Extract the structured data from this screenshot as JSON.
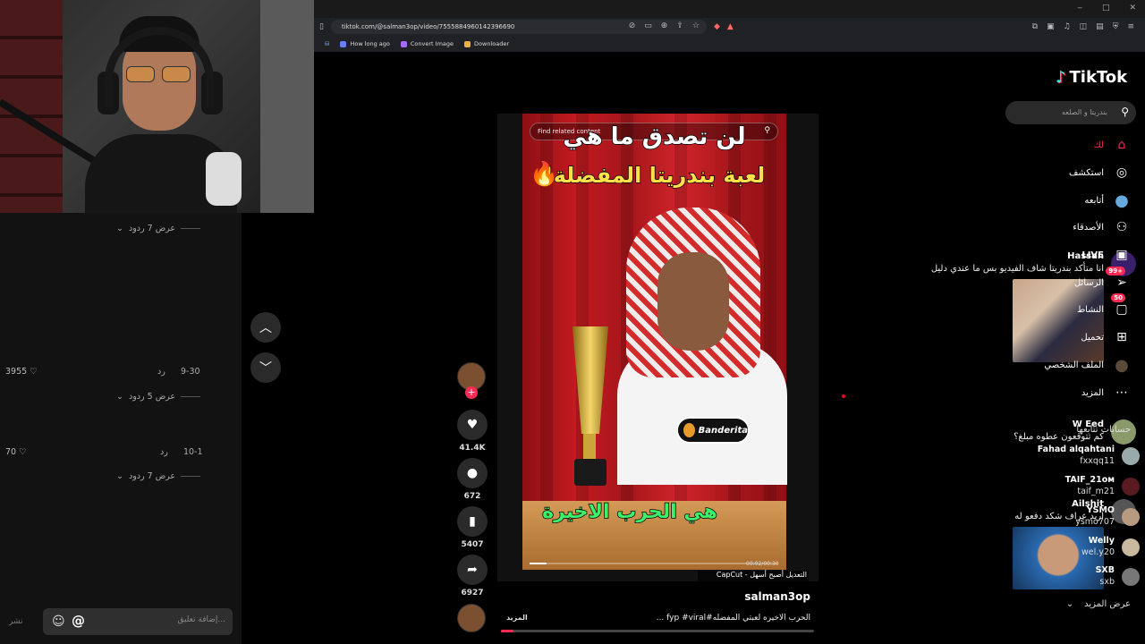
{
  "browser": {
    "url": "tiktok.com/@salman3op/video/7555884960142396690",
    "bookmarks": [
      "How long ago",
      "Convert Image",
      "Downloader"
    ],
    "window_controls": [
      "‒",
      "□",
      "✕"
    ]
  },
  "comments_panel": {
    "reply_toggles": [
      "عرض 7 ردود",
      "عرض 5 ردود",
      "عرض 7 ردود"
    ],
    "comments": [
      {
        "user": "Hassan",
        "text": "انا متأكد بندريتا شاف الفيديو بس ما عندي دليل",
        "date": "9-30",
        "reply": "رد",
        "likes": "3955",
        "avatar_color": "#3a1f6a"
      },
      {
        "user": "W Eed",
        "text": "كم تتوقعون عطوه مبلغ؟",
        "date": "10-1",
        "reply": "رد",
        "likes": "70",
        "avatar_color": "#8a9a6a"
      },
      {
        "user": "Ailshit",
        "text": "اريد عراف شكد دفعو له",
        "date": "",
        "reply": "",
        "likes": "",
        "avatar_color": "#555"
      }
    ],
    "input_placeholder": "إضافة تعليق...",
    "post_label": "نشر"
  },
  "video": {
    "search_placeholder": "Find related content",
    "headline_line1": "لن تصدق ما هي",
    "headline_line2": "لعبة بندريتا المفضلة!",
    "bottom_caption": "هي الحرب الاخيرة",
    "sticker_label": "Banderita",
    "time": "00:02/00:30",
    "progress": 0.07,
    "capcut_label": "التعديل أصبح أسهل - CapCut",
    "author": "salman3op",
    "description": "الحرب الاخيره لعبتي المفضله#fyp #viral ...",
    "more_label": "المزيد"
  },
  "actions": {
    "likes": "41.4K",
    "comments": "672",
    "saves": "5407",
    "shares": "6927"
  },
  "sidebar": {
    "logo": "TikTok",
    "search_placeholder": "بندريتا و الصلعه",
    "menu": [
      {
        "label": "لك",
        "icon": "home-icon",
        "glyph": "⌂",
        "badge": ""
      },
      {
        "label": "استكشف",
        "icon": "compass-icon",
        "glyph": "◎",
        "badge": ""
      },
      {
        "label": "أتابعه",
        "icon": "following-avatar-icon",
        "glyph": "●",
        "badge": ""
      },
      {
        "label": "الأصدقاء",
        "icon": "friends-icon",
        "glyph": "⚇",
        "badge": ""
      },
      {
        "label": "LIVE",
        "icon": "live-icon",
        "glyph": "▣",
        "badge": ""
      },
      {
        "label": "الرسائل",
        "icon": "messages-icon",
        "glyph": "➢",
        "badge": "99+"
      },
      {
        "label": "النشاط",
        "icon": "activity-icon",
        "glyph": "▢",
        "badge": "50"
      },
      {
        "label": "تحميل",
        "icon": "upload-icon",
        "glyph": "⊞",
        "badge": ""
      },
      {
        "label": "الملف الشخصي",
        "icon": "profile-avatar-icon",
        "glyph": "●",
        "badge": ""
      },
      {
        "label": "المزيد",
        "icon": "more-icon",
        "glyph": "⋯",
        "badge": ""
      }
    ],
    "following_title": "حسابات تتابعها",
    "following": [
      {
        "name": "Fahad alqahtani",
        "handle": "fxxqq11",
        "color": "#9aa"
      },
      {
        "name": "TAIF_21ᴏᴍ",
        "handle": "taif_m21",
        "color": "#5a1a22"
      },
      {
        "name": "YSMO",
        "handle": "ysmo707",
        "color": "#b89a80"
      },
      {
        "name": "Welly",
        "handle": "wel.y20",
        "color": "#c9b8a0"
      },
      {
        "name": "SXB",
        "handle": "sxb",
        "color": "#777"
      }
    ],
    "see_more": "عرض المزيد"
  },
  "colors": {
    "accent": "#fe2c55",
    "background": "#000000",
    "panel": "#121212"
  }
}
